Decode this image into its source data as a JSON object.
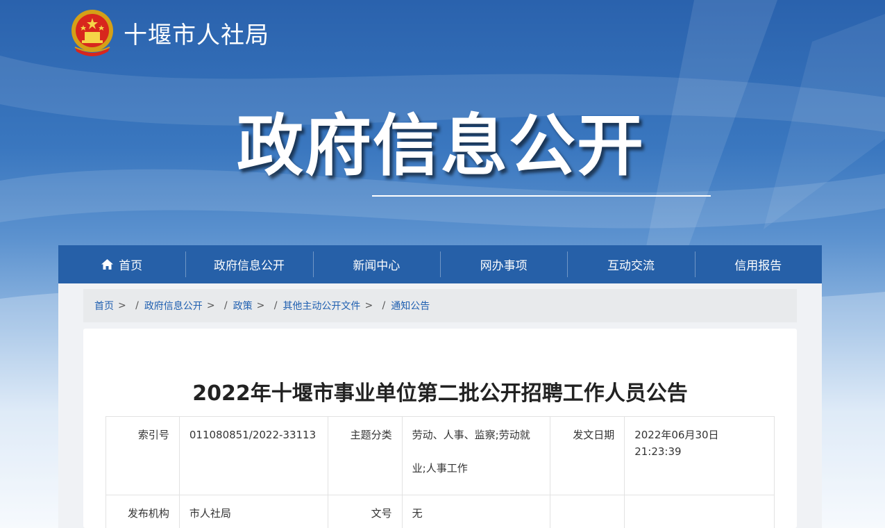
{
  "header": {
    "site_name": "十堰市人社局",
    "hero_title": "政府信息公开"
  },
  "nav": {
    "items": [
      {
        "label": "首页",
        "icon": "home-icon"
      },
      {
        "label": "政府信息公开"
      },
      {
        "label": "新闻中心"
      },
      {
        "label": "网办事项"
      },
      {
        "label": "互动交流"
      },
      {
        "label": "信用报告"
      }
    ]
  },
  "breadcrumb": {
    "items": [
      "首页",
      "政府信息公开",
      "政策",
      "其他主动公开文件",
      "通知公告"
    ],
    "separator": ">",
    "slash": "/"
  },
  "article": {
    "title": "2022年十堰市事业单位第二批公开招聘工作人员公告",
    "meta": {
      "index_label": "索引号",
      "index_value": "011080851/2022-33113",
      "topic_label": "主题分类",
      "topic_value": "劳动、人事、监察;劳动就业;人事工作",
      "date_label": "发文日期",
      "date_value": "2022年06月30日 21:23:39",
      "publisher_label": "发布机构",
      "publisher_value": "市人社局",
      "docno_label": "文号",
      "docno_value": "无"
    }
  },
  "colors": {
    "nav_bg": "#2660a8",
    "link": "#1f5fb0",
    "banner_top": "#2a62ad"
  }
}
